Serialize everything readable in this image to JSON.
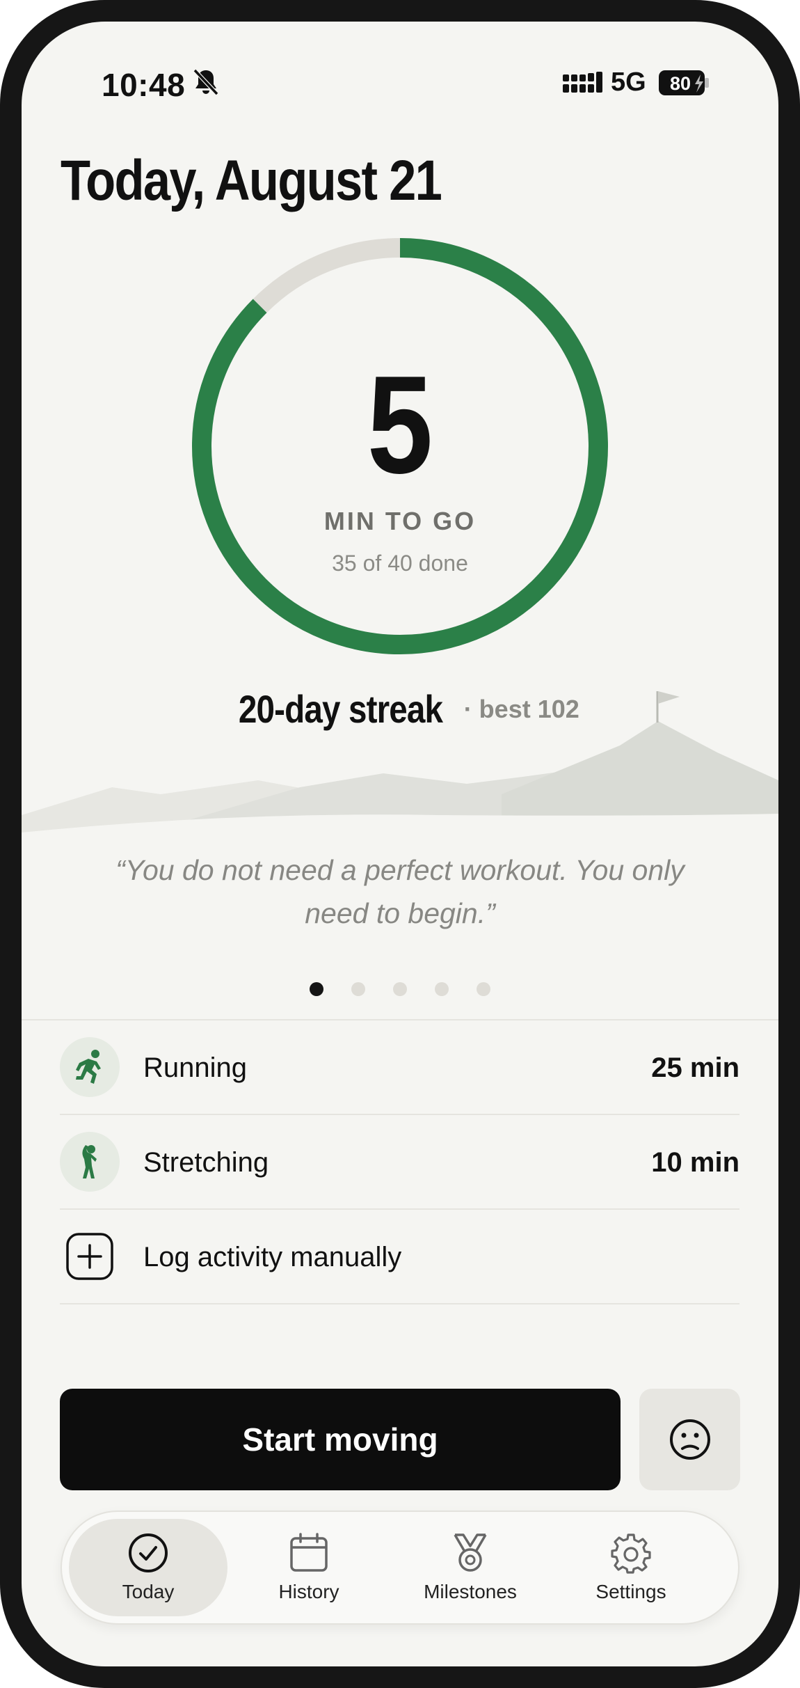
{
  "status_bar": {
    "time": "10:48",
    "network": "5G",
    "battery": "80"
  },
  "header": {
    "title": "Today, August 21"
  },
  "progress": {
    "remaining_value": "5",
    "remaining_label": "MIN TO GO",
    "done_text": "35 of 40 done",
    "done_minutes": 35,
    "goal_minutes": 40,
    "ring_color": "#2b8048",
    "track_color": "#dedcd6"
  },
  "streak": {
    "main": "20-day streak",
    "best": "· best 102"
  },
  "quote": {
    "text": "“You do not need a perfect workout. You only need to begin.”",
    "page_count": 5,
    "active_page": 1
  },
  "activities": [
    {
      "icon": "running-icon",
      "label": "Running",
      "value": "25 min"
    },
    {
      "icon": "stretching-icon",
      "label": "Stretching",
      "value": "10 min"
    }
  ],
  "log_manual": {
    "icon": "plus-square-icon",
    "label": "Log activity manually"
  },
  "actions": {
    "start_label": "Start moving",
    "mood_icon": "neutral-face-icon"
  },
  "tabs": [
    {
      "icon": "check-circle-icon",
      "label": "Today",
      "active": true
    },
    {
      "icon": "calendar-icon",
      "label": "History",
      "active": false
    },
    {
      "icon": "medal-icon",
      "label": "Milestones",
      "active": false
    },
    {
      "icon": "gear-icon",
      "label": "Settings",
      "active": false
    }
  ]
}
